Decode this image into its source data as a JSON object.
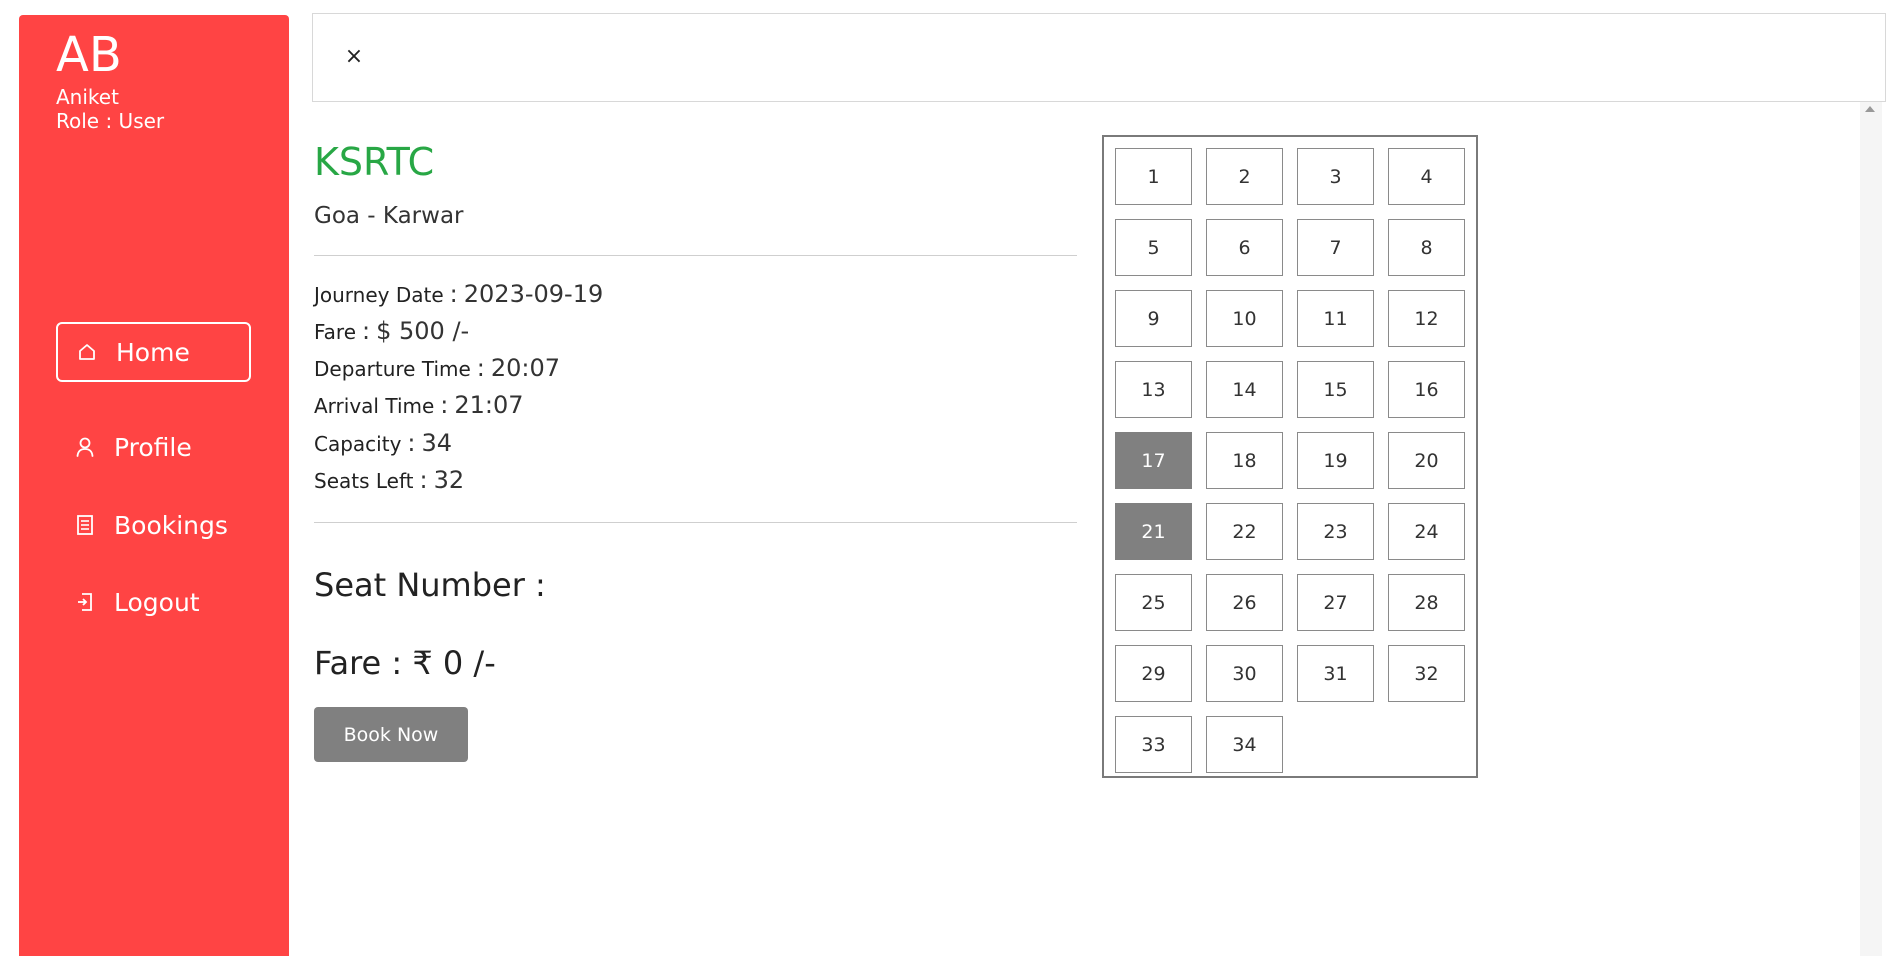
{
  "user": {
    "initials": "AB",
    "name": "Aniket",
    "role": "Role : User"
  },
  "nav": {
    "home": "Home",
    "profile": "Profile",
    "bookings": "Bookings",
    "logout": "Logout"
  },
  "topbar": {
    "close": "×"
  },
  "bus": {
    "name": "KSRTC",
    "route": "Goa - Karwar",
    "details": {
      "journey_date_label": "Journey Date",
      "journey_date": "2023-09-19",
      "fare_label": "Fare",
      "fare": "$ 500 /-",
      "departure_label": "Departure Time",
      "departure": "20:07",
      "arrival_label": "Arrival Time",
      "arrival": "21:07",
      "capacity_label": "Capacity",
      "capacity": "34",
      "seats_left_label": "Seats Left",
      "seats_left": "32",
      "separator": ":"
    }
  },
  "booking": {
    "seat_number_label": "Seat Number :",
    "fare_label": "Fare :",
    "fare_value": "₹ 0 /-",
    "book_button": "Book Now"
  },
  "seats": {
    "total": 34,
    "booked": [
      17,
      21
    ],
    "labels": [
      "1",
      "2",
      "3",
      "4",
      "5",
      "6",
      "7",
      "8",
      "9",
      "10",
      "11",
      "12",
      "13",
      "14",
      "15",
      "16",
      "17",
      "18",
      "19",
      "20",
      "21",
      "22",
      "23",
      "24",
      "25",
      "26",
      "27",
      "28",
      "29",
      "30",
      "31",
      "32",
      "33",
      "34"
    ]
  },
  "colors": {
    "sidebar": "#ff4444",
    "bus_name": "#28a745",
    "booked_seat": "#808080",
    "button": "#808080"
  }
}
